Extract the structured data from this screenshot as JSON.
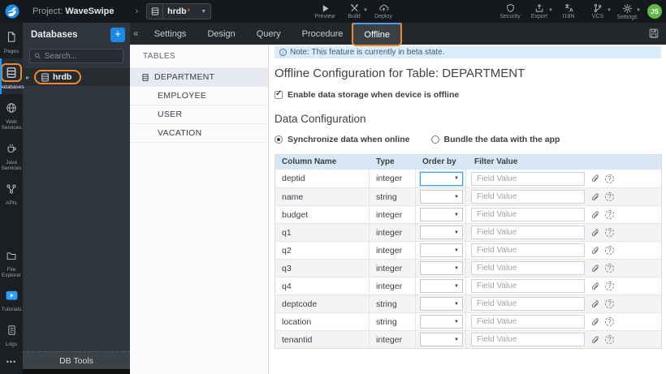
{
  "topbar": {
    "project_label": "Project:",
    "project_name": "WaveSwipe",
    "breadcrumb_chevron": "›",
    "db_selector": {
      "value": "hrdb",
      "dirty_mark": "*"
    },
    "actions": [
      {
        "label": "Preview",
        "icon": "preview-icon",
        "has_caret": false
      },
      {
        "label": "Build",
        "icon": "build-icon",
        "has_caret": true
      },
      {
        "label": "Deploy",
        "icon": "deploy-icon",
        "has_caret": false
      }
    ],
    "right_actions": [
      {
        "label": "Security",
        "icon": "shield-icon",
        "has_caret": false
      },
      {
        "label": "Export",
        "icon": "export-icon",
        "has_caret": true
      },
      {
        "label": "I18N",
        "icon": "translate-icon",
        "has_caret": false
      },
      {
        "label": "VCS",
        "icon": "branch-icon",
        "has_caret": true
      },
      {
        "label": "Settings",
        "icon": "gear-icon",
        "has_caret": true
      }
    ],
    "avatar_initials": "JS"
  },
  "sidebar": {
    "items": [
      {
        "label": "Pages",
        "icon": "page-icon",
        "active": false
      },
      {
        "label": "Databases",
        "icon": "database-icon",
        "active": true
      },
      {
        "label": "Web Services",
        "icon": "globe-icon",
        "active": false
      },
      {
        "label": "Java Services",
        "icon": "coffee-icon",
        "active": false
      },
      {
        "label": "APIs",
        "icon": "api-icon",
        "active": false
      }
    ],
    "bottom_items": [
      {
        "label": "File Explorer",
        "icon": "folder-icon"
      },
      {
        "label": "Tutorials",
        "icon": "video-play-icon"
      },
      {
        "label": "Logs",
        "icon": "log-file-icon"
      }
    ],
    "more": "•••"
  },
  "db_panel": {
    "title": "Databases",
    "add_button": "+",
    "search_placeholder": "Search...",
    "expander": "▸",
    "items": [
      {
        "label": "hrdb"
      }
    ],
    "footer": "DB Tools"
  },
  "tabbar": {
    "collapse": "«",
    "tabs": [
      {
        "label": "Settings",
        "active": false
      },
      {
        "label": "Design",
        "active": false
      },
      {
        "label": "Query",
        "active": false
      },
      {
        "label": "Procedure",
        "active": false
      },
      {
        "label": "Offline",
        "active": true
      }
    ]
  },
  "tables_panel": {
    "title": "TABLES",
    "items": [
      {
        "label": "DEPARTMENT",
        "selected": true
      },
      {
        "label": "EMPLOYEE",
        "selected": false
      },
      {
        "label": "USER",
        "selected": false
      },
      {
        "label": "VACATION",
        "selected": false
      }
    ]
  },
  "main": {
    "note": "Note: This feature is currently in beta state.",
    "title": "Offline Configuration for Table: DEPARTMENT",
    "enable_checkbox_label": "Enable data storage when device is offline",
    "enable_checkbox_checked": true,
    "section_title": "Data Configuration",
    "radios": [
      {
        "label": "Synchronize data when online",
        "selected": true
      },
      {
        "label": "Bundle the data with the app",
        "selected": false
      }
    ],
    "config_table": {
      "headers": [
        "Column Name",
        "Type",
        "Order by",
        "Filter Value"
      ],
      "filter_placeholder": "Field Value",
      "order_by_selected": "",
      "rows": [
        {
          "column": "deptid",
          "type": "integer"
        },
        {
          "column": "name",
          "type": "string"
        },
        {
          "column": "budget",
          "type": "integer"
        },
        {
          "column": "q1",
          "type": "integer"
        },
        {
          "column": "q2",
          "type": "integer"
        },
        {
          "column": "q3",
          "type": "integer"
        },
        {
          "column": "q4",
          "type": "integer"
        },
        {
          "column": "deptcode",
          "type": "string"
        },
        {
          "column": "location",
          "type": "string"
        },
        {
          "column": "tenantid",
          "type": "integer"
        }
      ]
    }
  },
  "colors": {
    "accent_blue": "#2196f3",
    "annotation_orange": "#ee8a2a",
    "note_bg": "#d9ecf9",
    "table_header_bg": "#d8e7f6",
    "avatar_green": "#61b944"
  }
}
